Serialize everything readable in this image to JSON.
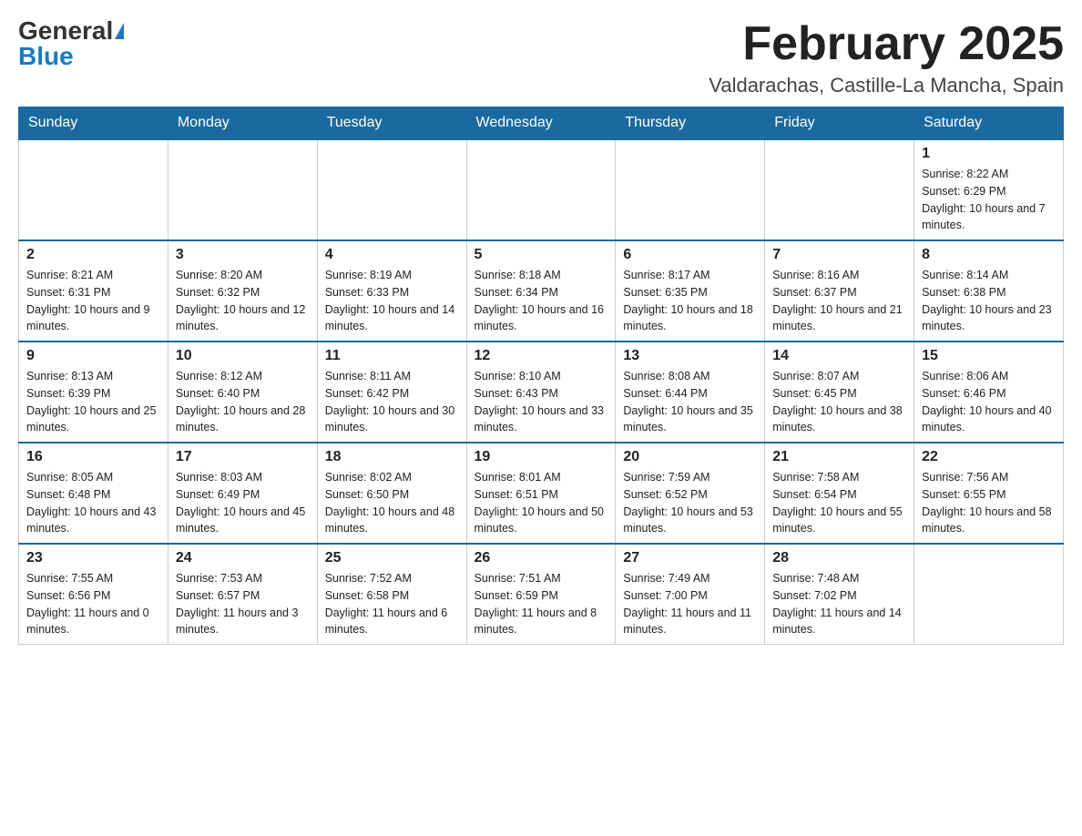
{
  "header": {
    "logo_general": "General",
    "logo_blue": "Blue",
    "title": "February 2025",
    "location": "Valdarachas, Castille-La Mancha, Spain"
  },
  "weekdays": [
    "Sunday",
    "Monday",
    "Tuesday",
    "Wednesday",
    "Thursday",
    "Friday",
    "Saturday"
  ],
  "weeks": [
    [
      {
        "day": "",
        "info": ""
      },
      {
        "day": "",
        "info": ""
      },
      {
        "day": "",
        "info": ""
      },
      {
        "day": "",
        "info": ""
      },
      {
        "day": "",
        "info": ""
      },
      {
        "day": "",
        "info": ""
      },
      {
        "day": "1",
        "info": "Sunrise: 8:22 AM\nSunset: 6:29 PM\nDaylight: 10 hours and 7 minutes."
      }
    ],
    [
      {
        "day": "2",
        "info": "Sunrise: 8:21 AM\nSunset: 6:31 PM\nDaylight: 10 hours and 9 minutes."
      },
      {
        "day": "3",
        "info": "Sunrise: 8:20 AM\nSunset: 6:32 PM\nDaylight: 10 hours and 12 minutes."
      },
      {
        "day": "4",
        "info": "Sunrise: 8:19 AM\nSunset: 6:33 PM\nDaylight: 10 hours and 14 minutes."
      },
      {
        "day": "5",
        "info": "Sunrise: 8:18 AM\nSunset: 6:34 PM\nDaylight: 10 hours and 16 minutes."
      },
      {
        "day": "6",
        "info": "Sunrise: 8:17 AM\nSunset: 6:35 PM\nDaylight: 10 hours and 18 minutes."
      },
      {
        "day": "7",
        "info": "Sunrise: 8:16 AM\nSunset: 6:37 PM\nDaylight: 10 hours and 21 minutes."
      },
      {
        "day": "8",
        "info": "Sunrise: 8:14 AM\nSunset: 6:38 PM\nDaylight: 10 hours and 23 minutes."
      }
    ],
    [
      {
        "day": "9",
        "info": "Sunrise: 8:13 AM\nSunset: 6:39 PM\nDaylight: 10 hours and 25 minutes."
      },
      {
        "day": "10",
        "info": "Sunrise: 8:12 AM\nSunset: 6:40 PM\nDaylight: 10 hours and 28 minutes."
      },
      {
        "day": "11",
        "info": "Sunrise: 8:11 AM\nSunset: 6:42 PM\nDaylight: 10 hours and 30 minutes."
      },
      {
        "day": "12",
        "info": "Sunrise: 8:10 AM\nSunset: 6:43 PM\nDaylight: 10 hours and 33 minutes."
      },
      {
        "day": "13",
        "info": "Sunrise: 8:08 AM\nSunset: 6:44 PM\nDaylight: 10 hours and 35 minutes."
      },
      {
        "day": "14",
        "info": "Sunrise: 8:07 AM\nSunset: 6:45 PM\nDaylight: 10 hours and 38 minutes."
      },
      {
        "day": "15",
        "info": "Sunrise: 8:06 AM\nSunset: 6:46 PM\nDaylight: 10 hours and 40 minutes."
      }
    ],
    [
      {
        "day": "16",
        "info": "Sunrise: 8:05 AM\nSunset: 6:48 PM\nDaylight: 10 hours and 43 minutes."
      },
      {
        "day": "17",
        "info": "Sunrise: 8:03 AM\nSunset: 6:49 PM\nDaylight: 10 hours and 45 minutes."
      },
      {
        "day": "18",
        "info": "Sunrise: 8:02 AM\nSunset: 6:50 PM\nDaylight: 10 hours and 48 minutes."
      },
      {
        "day": "19",
        "info": "Sunrise: 8:01 AM\nSunset: 6:51 PM\nDaylight: 10 hours and 50 minutes."
      },
      {
        "day": "20",
        "info": "Sunrise: 7:59 AM\nSunset: 6:52 PM\nDaylight: 10 hours and 53 minutes."
      },
      {
        "day": "21",
        "info": "Sunrise: 7:58 AM\nSunset: 6:54 PM\nDaylight: 10 hours and 55 minutes."
      },
      {
        "day": "22",
        "info": "Sunrise: 7:56 AM\nSunset: 6:55 PM\nDaylight: 10 hours and 58 minutes."
      }
    ],
    [
      {
        "day": "23",
        "info": "Sunrise: 7:55 AM\nSunset: 6:56 PM\nDaylight: 11 hours and 0 minutes."
      },
      {
        "day": "24",
        "info": "Sunrise: 7:53 AM\nSunset: 6:57 PM\nDaylight: 11 hours and 3 minutes."
      },
      {
        "day": "25",
        "info": "Sunrise: 7:52 AM\nSunset: 6:58 PM\nDaylight: 11 hours and 6 minutes."
      },
      {
        "day": "26",
        "info": "Sunrise: 7:51 AM\nSunset: 6:59 PM\nDaylight: 11 hours and 8 minutes."
      },
      {
        "day": "27",
        "info": "Sunrise: 7:49 AM\nSunset: 7:00 PM\nDaylight: 11 hours and 11 minutes."
      },
      {
        "day": "28",
        "info": "Sunrise: 7:48 AM\nSunset: 7:02 PM\nDaylight: 11 hours and 14 minutes."
      },
      {
        "day": "",
        "info": ""
      }
    ]
  ]
}
